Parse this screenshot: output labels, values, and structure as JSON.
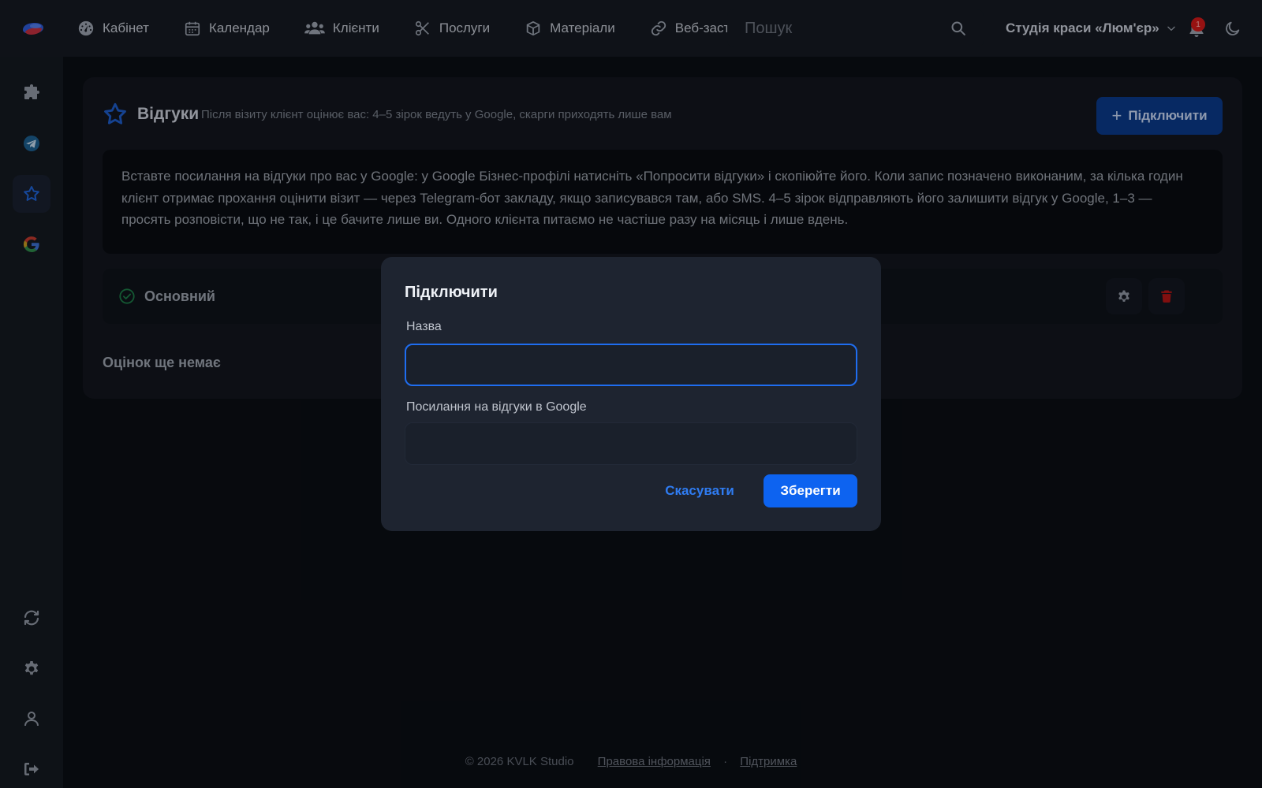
{
  "topbar": {
    "nav": [
      {
        "label": "Кабінет",
        "icon": "dashboard-icon"
      },
      {
        "label": "Календар",
        "icon": "calendar-icon"
      },
      {
        "label": "Клієнти",
        "icon": "users-icon"
      },
      {
        "label": "Послуги",
        "icon": "scissors-icon"
      },
      {
        "label": "Матеріали",
        "icon": "box-icon"
      },
      {
        "label": "Веб-застосунок",
        "icon": "link-icon"
      }
    ],
    "search_placeholder": "Пошук",
    "studio_name": "Студія краси «Люм'єр»",
    "notifications_count": "1"
  },
  "sidebar": {
    "items": [
      {
        "icon": "puzzle-icon",
        "active": false
      },
      {
        "icon": "telegram-icon",
        "active": false
      },
      {
        "icon": "star-icon",
        "active": true
      },
      {
        "icon": "google-icon",
        "active": false
      }
    ],
    "bottom_items": [
      {
        "icon": "refresh-icon"
      },
      {
        "icon": "gear-icon"
      },
      {
        "icon": "user-icon"
      },
      {
        "icon": "logout-icon"
      }
    ]
  },
  "page": {
    "title": "Відгуки",
    "subtitle": "Після візиту клієнт оцінює вас: 4–5 зірок ведуть у Google, скарги приходять лише вам",
    "connect_label": "Підключити",
    "info_text": "Вставте посилання на відгуки про вас у Google: у Google Бізнес-профілі натисніть «Попросити відгуки» і скопіюйте його. Коли запис позначено виконаним, за кілька годин клієнт отримає прохання оцінити візит — через Telegram-бот закладу, якщо записувався там, або SMS. 4–5 зірок відправляють його залишити відгук у Google, 1–3 — просять розповісти, що не так, і це бачите лише ви. Одного клієнта питаємо не частіше разу на місяць і лише вдень.",
    "review_source": {
      "name": "Основний",
      "status": "active"
    },
    "empty_text": "Оцінок ще немає"
  },
  "footer": {
    "copyright": "© 2026 KVLK Studio",
    "legal_link": "Правова інформація",
    "support_link": "Підтримка",
    "separator": "·"
  },
  "modal": {
    "title": "Підключити",
    "name_label": "Назва",
    "name_value": "",
    "link_label": "Посилання на відгуки в Google",
    "link_value": "",
    "cancel_label": "Скасувати",
    "save_label": "Зберегти"
  },
  "colors": {
    "accent": "#0d63f0",
    "danger": "#b51616",
    "success": "#1c7a47"
  }
}
